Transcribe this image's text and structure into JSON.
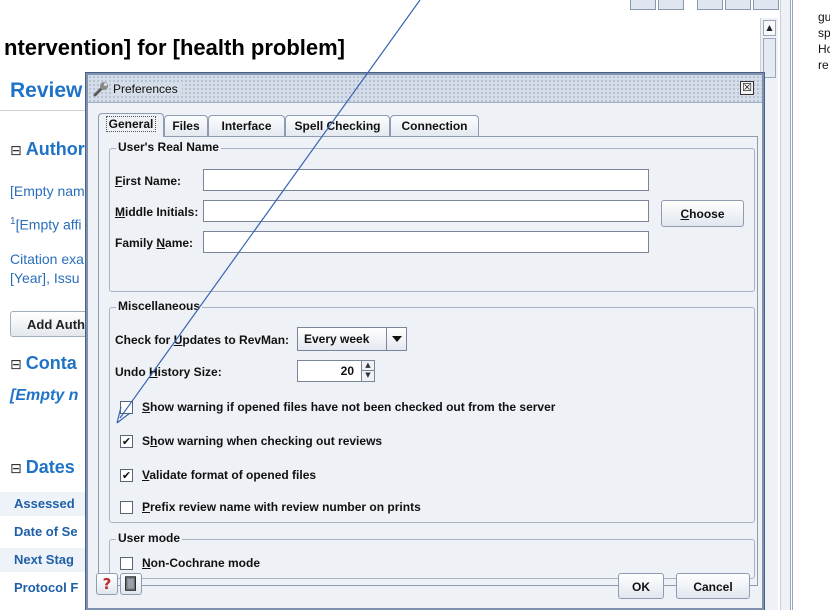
{
  "document": {
    "title": "ntervention] for [health problem]",
    "subtitle": "Review",
    "authors_heading": "Author",
    "empty_name": "[Empty nam",
    "superscript": "1",
    "empty_affiliation": "[Empty affi",
    "citation_line1": "Citation exa",
    "citation_line2": "[Year], Issu",
    "add_author_button": "Add Autho",
    "contact_heading": "Conta",
    "contact_empty": "[Empty n",
    "dates_heading": "Dates",
    "date_rows": [
      "Assessed",
      "Date of Se",
      "Next Stag",
      "Protocol F"
    ],
    "section_toggle": "⊟"
  },
  "right_panel": {
    "lines": [
      "gu",
      "sp",
      "Hc",
      "re"
    ]
  },
  "dialog": {
    "title": "Preferences",
    "close_glyph": "☒",
    "tabs": [
      "General",
      "Files",
      "Interface",
      "Spell Checking",
      "Connection"
    ],
    "active_tab": "General",
    "real_name_group": "User's Real Name",
    "first_name_label_u": "F",
    "first_name_label_rest": "irst Name:",
    "first_name_value": "",
    "middle_initials_label_u": "M",
    "middle_initials_label_rest": "iddle Initials:",
    "middle_initials_value": "",
    "family_name_label_pre": "Family ",
    "family_name_label_u": "N",
    "family_name_label_rest": "ame:",
    "family_name_value": "",
    "choose_button_u": "C",
    "choose_button_rest": "hoose",
    "misc_group": "Miscellaneous",
    "updates_label_pre": "Check for ",
    "updates_label_u": "U",
    "updates_label_rest": "pdates to RevMan:",
    "updates_value": "Every week",
    "undo_label_pre": "Undo ",
    "undo_label_u": "H",
    "undo_label_rest": "istory Size:",
    "undo_value": "20",
    "checkboxes": [
      {
        "u": "S",
        "rest": "how warning if opened files have not been checked out from the server",
        "checked": false
      },
      {
        "pre": "S",
        "u": "h",
        "rest": "ow warning when checking out reviews",
        "checked": true
      },
      {
        "u": "V",
        "rest": "alidate format of opened files",
        "checked": true
      },
      {
        "u": "P",
        "rest": "refix review name with review number on prints",
        "checked": false
      }
    ],
    "user_mode_group": "User mode",
    "non_cochrane_u": "N",
    "non_cochrane_rest": "on-Cochrane mode",
    "non_cochrane_checked": false,
    "check_glyph": "✔",
    "help_glyph": "?",
    "ok_button": "OK",
    "cancel_button": "Cancel"
  },
  "colors": {
    "accent": "#1f73c7",
    "annotation": "#3a64b5",
    "dialog_bg": "#eef1f5"
  }
}
